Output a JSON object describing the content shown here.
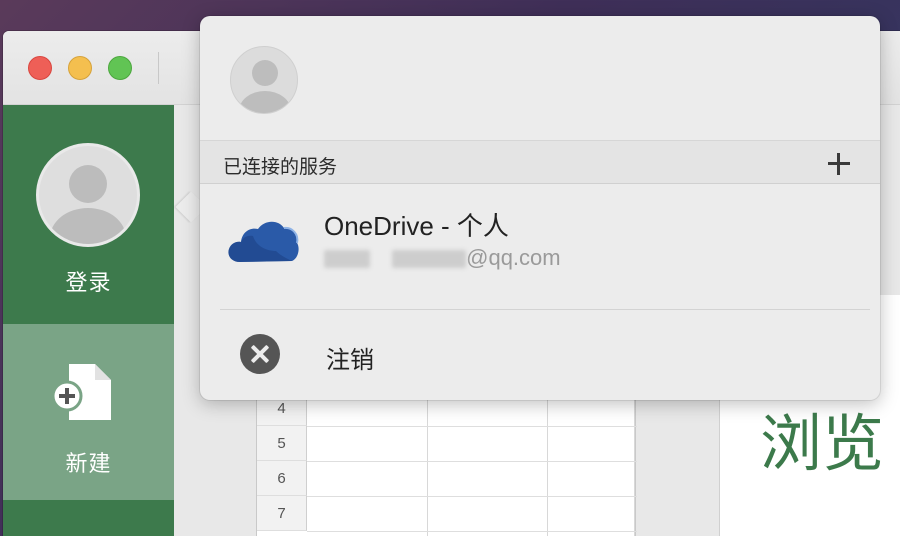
{
  "sidebar": {
    "login_label": "登录",
    "new_label": "新建"
  },
  "content": {
    "browse_text": "浏览",
    "sheet_rows": [
      "4",
      "5",
      "6",
      "7"
    ]
  },
  "popover": {
    "section_title": "已连接的服务",
    "services": [
      {
        "name": "OneDrive - 个人",
        "account_visible_suffix": "@qq.com",
        "icon": "onedrive-cloud-icon"
      }
    ],
    "signout_label": "注销"
  },
  "colors": {
    "excel_green": "#3d7a4c",
    "sidebar_selected": "#7aa486",
    "onedrive_blue": "#2a5aa8"
  }
}
